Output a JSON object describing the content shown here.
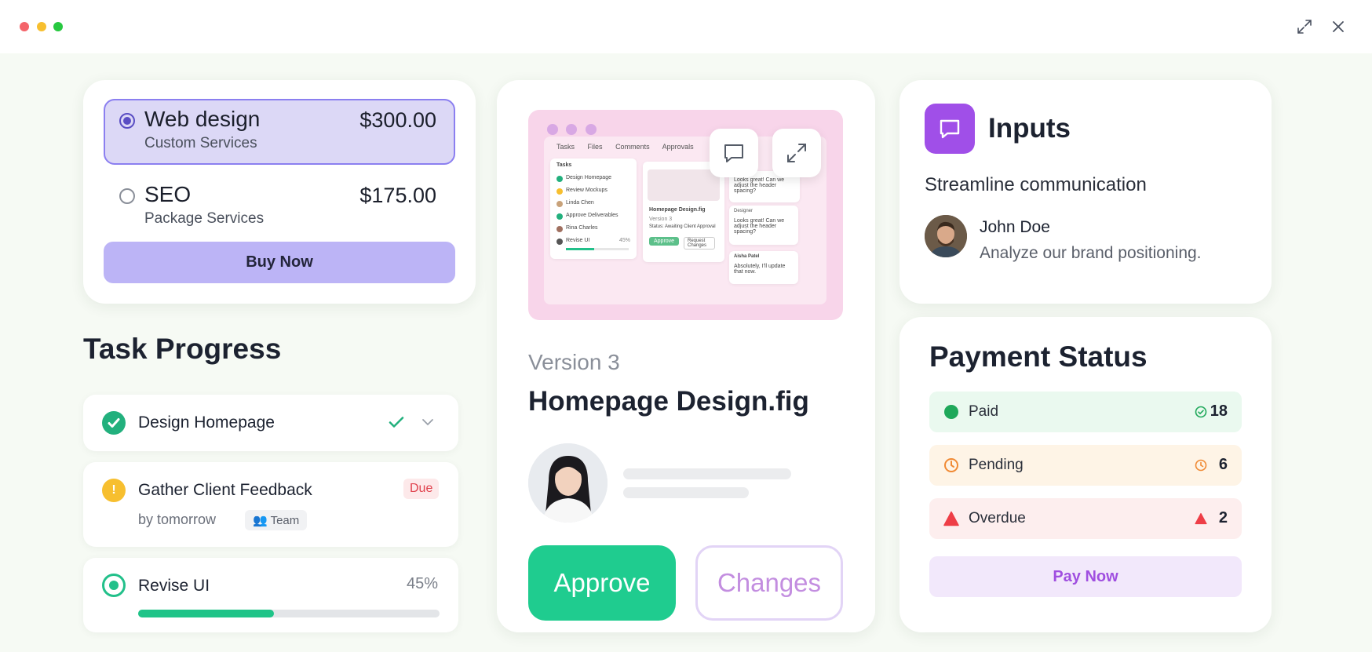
{
  "window": {
    "controls": [
      "close",
      "minimize",
      "zoom"
    ],
    "expand_icon": "expand-icon",
    "close_icon": "close-icon"
  },
  "pricing": {
    "plans": [
      {
        "name": "Web design",
        "subtitle": "Custom Services",
        "price": "$300.00",
        "selected": true
      },
      {
        "name": "SEO",
        "subtitle": "Package Services",
        "price": "$175.00",
        "selected": false
      }
    ],
    "buy_label": "Buy Now",
    "accent": "#8b7ff0"
  },
  "tasks": {
    "title": "Task Progress",
    "items": [
      {
        "name": "Design Homepage",
        "status": "done"
      },
      {
        "name": "Gather Client Feedback",
        "badge": "Due",
        "subtitle": "by tomorrow",
        "tag": "Team",
        "status": "warning"
      },
      {
        "name": "Revise UI",
        "progress_label": "45%",
        "progress": 0.45,
        "status": "in-progress"
      }
    ]
  },
  "review": {
    "version": "Version 3",
    "file_name": "Homepage Design.fig",
    "approve_label": "Approve",
    "changes_label": "Changes",
    "preview": {
      "tabs": [
        "Tasks",
        "Files",
        "Comments",
        "Approvals"
      ],
      "panel_title": "Tasks",
      "task_list": [
        "Design Homepage",
        "Review Mockups",
        "Linda Chen",
        "Approve Deliverables",
        "Rina Charles",
        "Revise UI"
      ],
      "task_pct": "45%",
      "file_title": "Homepage Design.fig",
      "file_version": "Version 3",
      "file_status": "Status: Awaiting Client Approval",
      "file_approve": "Approve",
      "file_request": "Request Changes",
      "comments": [
        "Looks great! Can we adjust the header spacing?",
        "Looks great! Can we adjust the header spacing?",
        "Absolutely, I'll update that now."
      ],
      "commenters": [
        "Designer",
        "Aisha Patel"
      ]
    }
  },
  "inputs": {
    "title": "Inputs",
    "subtitle": "Streamline communication",
    "user_name": "John Doe",
    "message": "Analyze our brand positioning.",
    "icon_color": "#a04fe8"
  },
  "payment": {
    "title": "Payment Status",
    "statuses": [
      {
        "label": "Paid",
        "count": "18",
        "color": "#1fa85a"
      },
      {
        "label": "Pending",
        "count": "6",
        "color": "#f08a34"
      },
      {
        "label": "Overdue",
        "count": "2",
        "color": "#ee3e47"
      }
    ],
    "pay_label": "Pay Now"
  }
}
